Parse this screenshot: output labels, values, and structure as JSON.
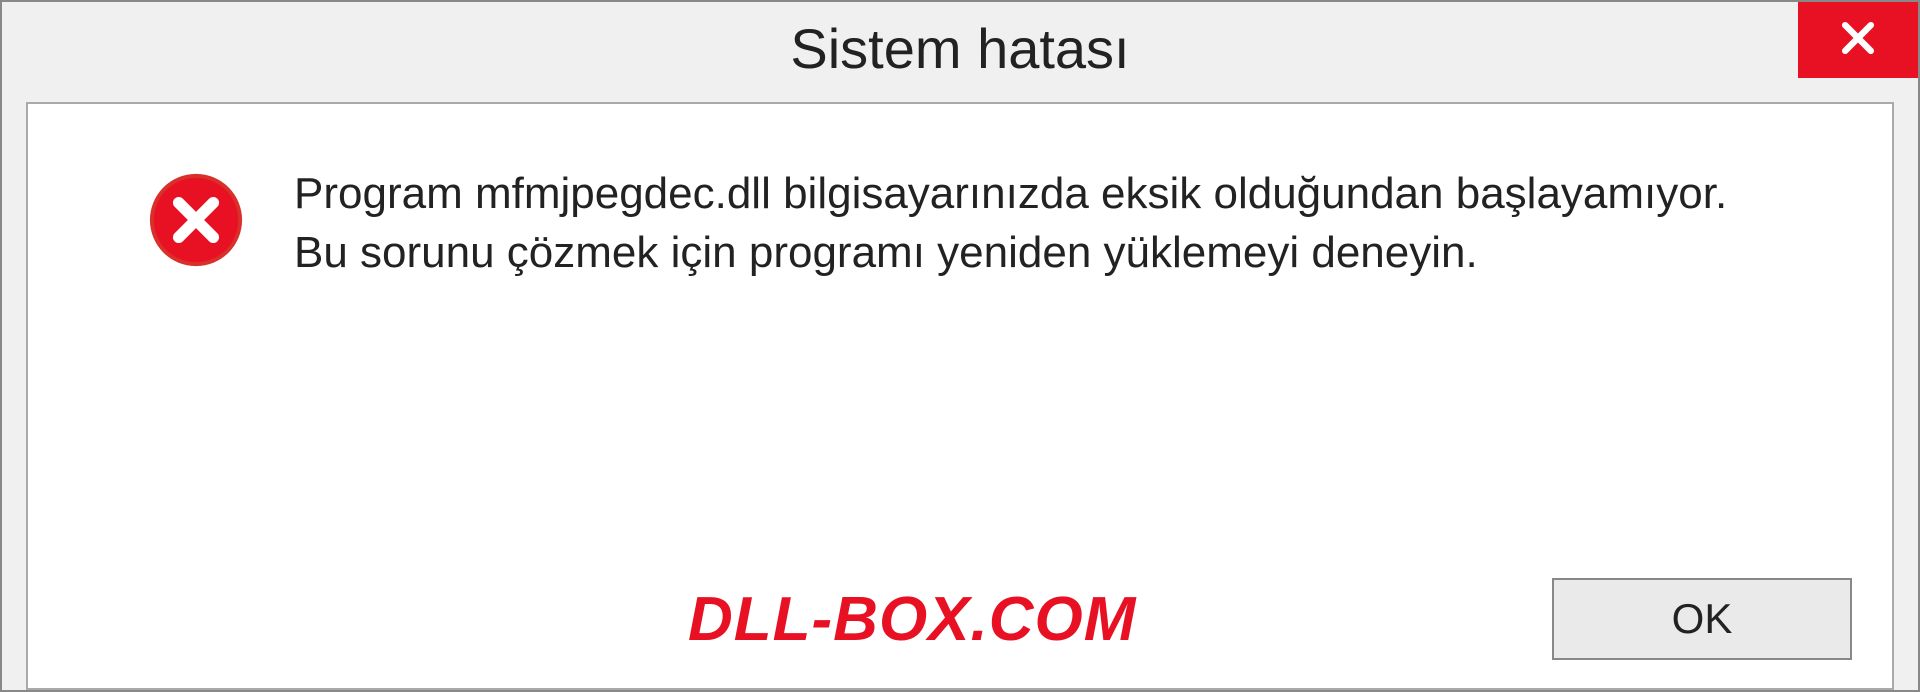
{
  "dialog": {
    "title": "Sistem hatası",
    "message": "Program mfmjpegdec.dll bilgisayarınızda eksik olduğundan başlayamıyor. Bu sorunu çözmek için programı yeniden yüklemeyi deneyin.",
    "ok_label": "OK",
    "watermark": "DLL-BOX.COM"
  },
  "colors": {
    "accent_red": "#e81123",
    "dialog_bg": "#f0f0f0",
    "border_gray": "#888"
  }
}
